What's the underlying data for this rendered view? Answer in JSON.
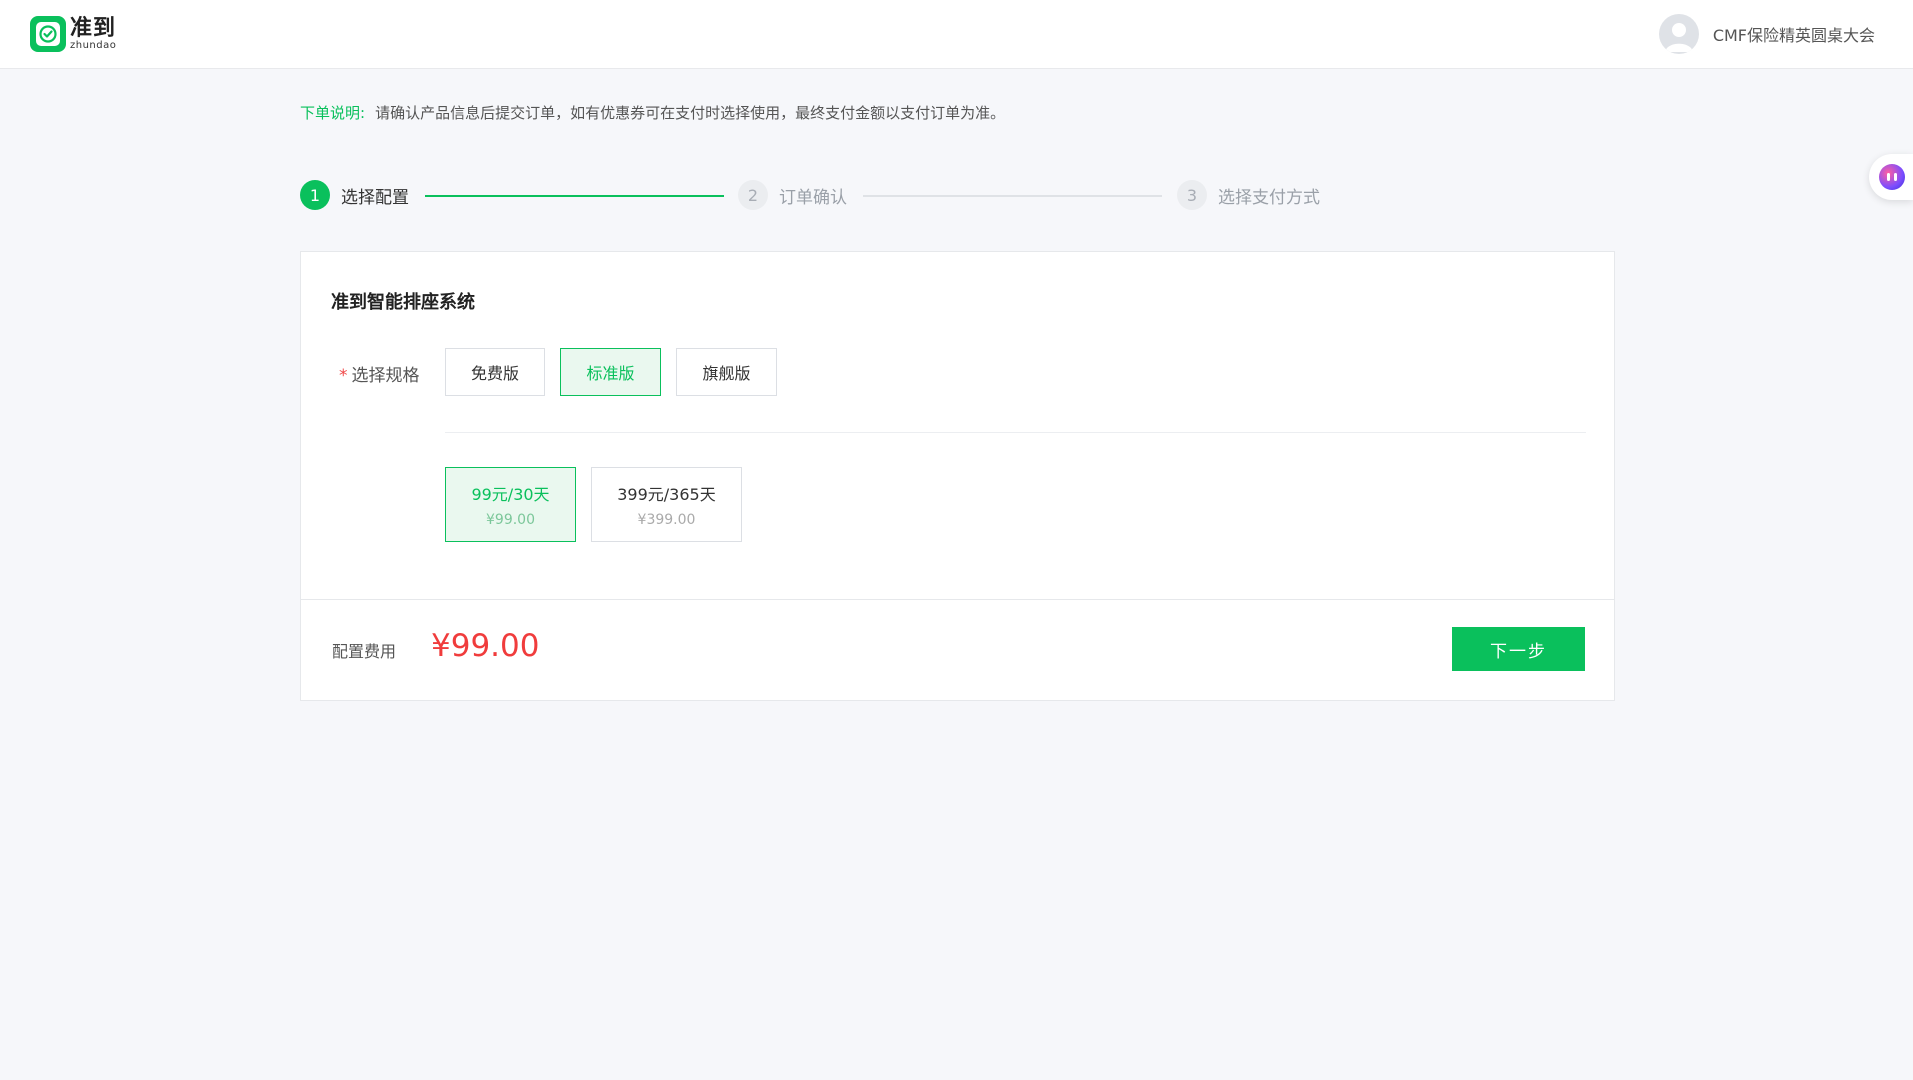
{
  "header": {
    "logo_cn": "准到",
    "logo_en": "zhundao",
    "user_name": "CMF保险精英圆桌大会"
  },
  "notice": {
    "label": "下单说明:",
    "text": "请确认产品信息后提交订单，如有优惠券可在支付时选择使用，最终支付金额以支付订单为准。"
  },
  "steps": [
    {
      "number": "1",
      "label": "选择配置",
      "state": "active"
    },
    {
      "number": "2",
      "label": "订单确认",
      "state": "todo"
    },
    {
      "number": "3",
      "label": "选择支付方式",
      "state": "todo"
    }
  ],
  "product": {
    "title": "准到智能排座系统",
    "spec_required_mark": "*",
    "spec_label": "选择规格",
    "spec_options": [
      {
        "label": "免费版",
        "selected": false
      },
      {
        "label": "标准版",
        "selected": true
      },
      {
        "label": "旗舰版",
        "selected": false
      }
    ],
    "price_options": [
      {
        "title": "99元/30天",
        "price": "¥99.00",
        "selected": true
      },
      {
        "title": "399元/365天",
        "price": "¥399.00",
        "selected": false
      }
    ]
  },
  "footer": {
    "fee_label": "配置费用",
    "fee_value": "¥99.00",
    "next_label": "下一步"
  },
  "colors": {
    "brand_green": "#0ac05c",
    "price_red": "#f03c3c",
    "required_red": "#f04848"
  },
  "icons": {
    "logo": "zhundao-check-logo-icon",
    "avatar": "user-avatar-icon",
    "float": "assistant-orb-icon"
  }
}
